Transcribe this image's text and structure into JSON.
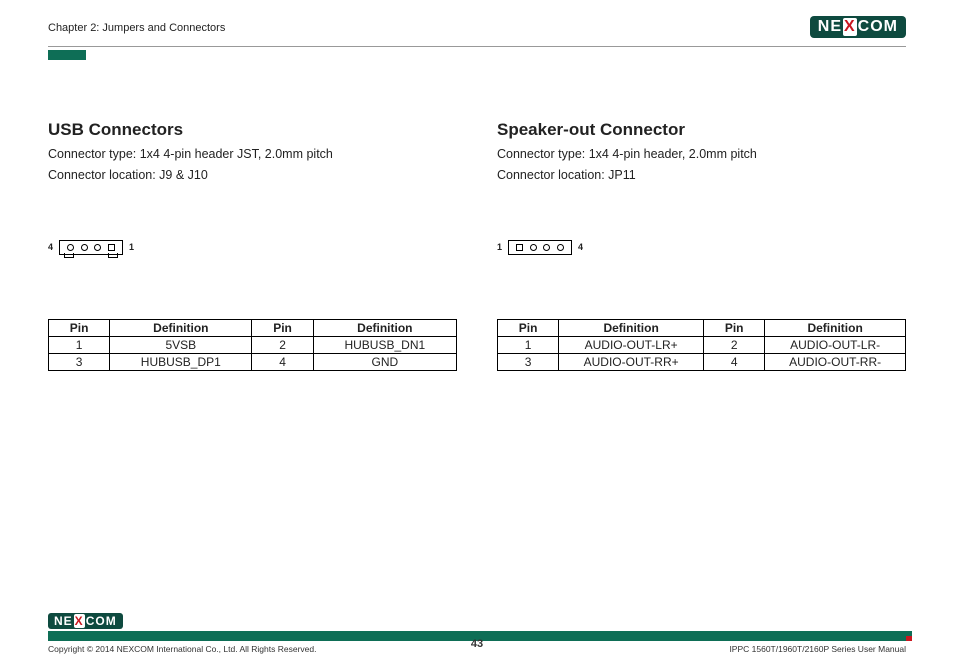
{
  "header": {
    "chapter": "Chapter 2: Jumpers and Connectors",
    "brand_left": "NE",
    "brand_x": "X",
    "brand_right": "COM"
  },
  "left": {
    "title": "USB Connectors",
    "desc1": "Connector type: 1x4 4-pin header JST, 2.0mm pitch",
    "desc2": "Connector location: J9 & J10",
    "label_left": "4",
    "label_right": "1",
    "th_pin": "Pin",
    "th_def": "Definition",
    "r1c1": "1",
    "r1c2": "5VSB",
    "r1c3": "2",
    "r1c4": "HUBUSB_DN1",
    "r2c1": "3",
    "r2c2": "HUBUSB_DP1",
    "r2c3": "4",
    "r2c4": "GND"
  },
  "right": {
    "title": "Speaker-out Connector",
    "desc1": "Connector type: 1x4 4-pin header, 2.0mm pitch",
    "desc2": "Connector location: JP11",
    "label_left": "1",
    "label_right": "4",
    "th_pin": "Pin",
    "th_def": "Definition",
    "r1c1": "1",
    "r1c2": "AUDIO-OUT-LR+",
    "r1c3": "2",
    "r1c4": "AUDIO-OUT-LR-",
    "r2c1": "3",
    "r2c2": "AUDIO-OUT-RR+",
    "r2c3": "4",
    "r2c4": "AUDIO-OUT-RR-"
  },
  "footer": {
    "copyright": "Copyright © 2014 NEXCOM International Co., Ltd. All Rights Reserved.",
    "page": "43",
    "manual": "IPPC 1560T/1960T/2160P Series User Manual"
  }
}
